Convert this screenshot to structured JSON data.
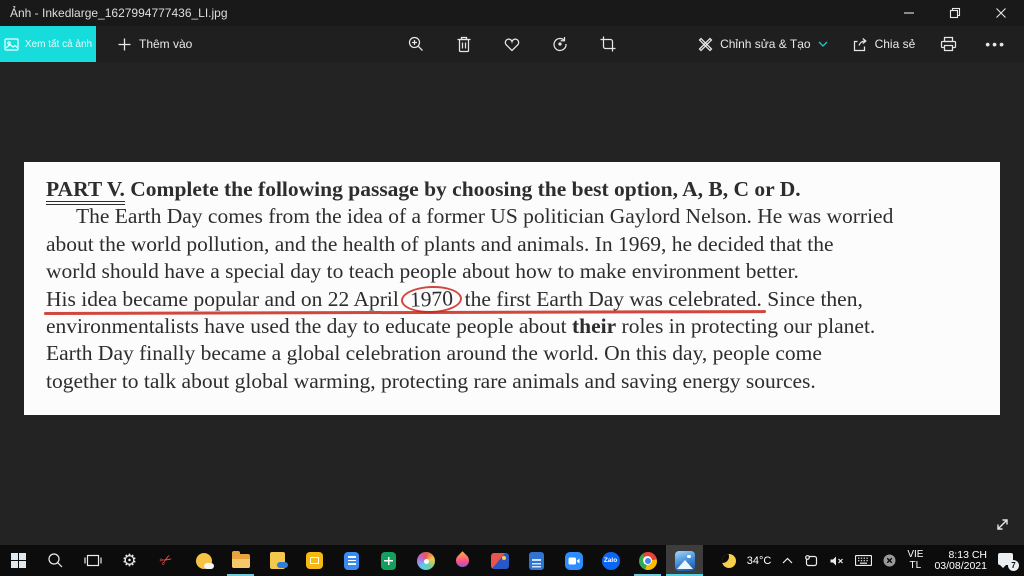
{
  "window": {
    "title": "Ảnh - Inkedlarge_1627994777436_LI.jpg"
  },
  "toolbar": {
    "view_all": "Xem tất cả ảnh",
    "add_to": "Thêm vào",
    "edit_create": "Chỉnh sửa & Tạo",
    "share": "Chia sẻ"
  },
  "doc": {
    "heading_part": "PART V.",
    "heading_rest": " Complete the following passage by choosing the best option, A, B, C or D.",
    "line1": "The Earth Day comes from the idea of a former US politician Gaylord Nelson. He was worried",
    "line2": "about the world pollution, and the health of plants and animals. In 1969, he decided that the",
    "line3": "world should have a special day to teach people about how to make environment better.",
    "line4a": "His idea became popular and on 22 April ",
    "line4b": "1970",
    "line4c": " the first Earth Day was celebrated.",
    "line4d": " Since then,",
    "line5a": "environmentalists have used the day to educate people about ",
    "line5b": "their",
    "line5c": " roles in protecting our planet.",
    "line6": "Earth Day finally became a global celebration around the world. On this day, people come",
    "line7": "together to talk about global warming, protecting rare animals and saving energy sources."
  },
  "taskbar": {
    "zalo_label": "Zalo"
  },
  "tray": {
    "temperature": "34°C",
    "lang1": "VIE",
    "lang2": "TL",
    "time": "8:13 CH",
    "date": "03/08/2021",
    "badge": "7"
  },
  "colors": {
    "accent_teal": "#17dcdc",
    "annotation_red": "#c9271b",
    "open_app_underline": "#6fc9da"
  }
}
